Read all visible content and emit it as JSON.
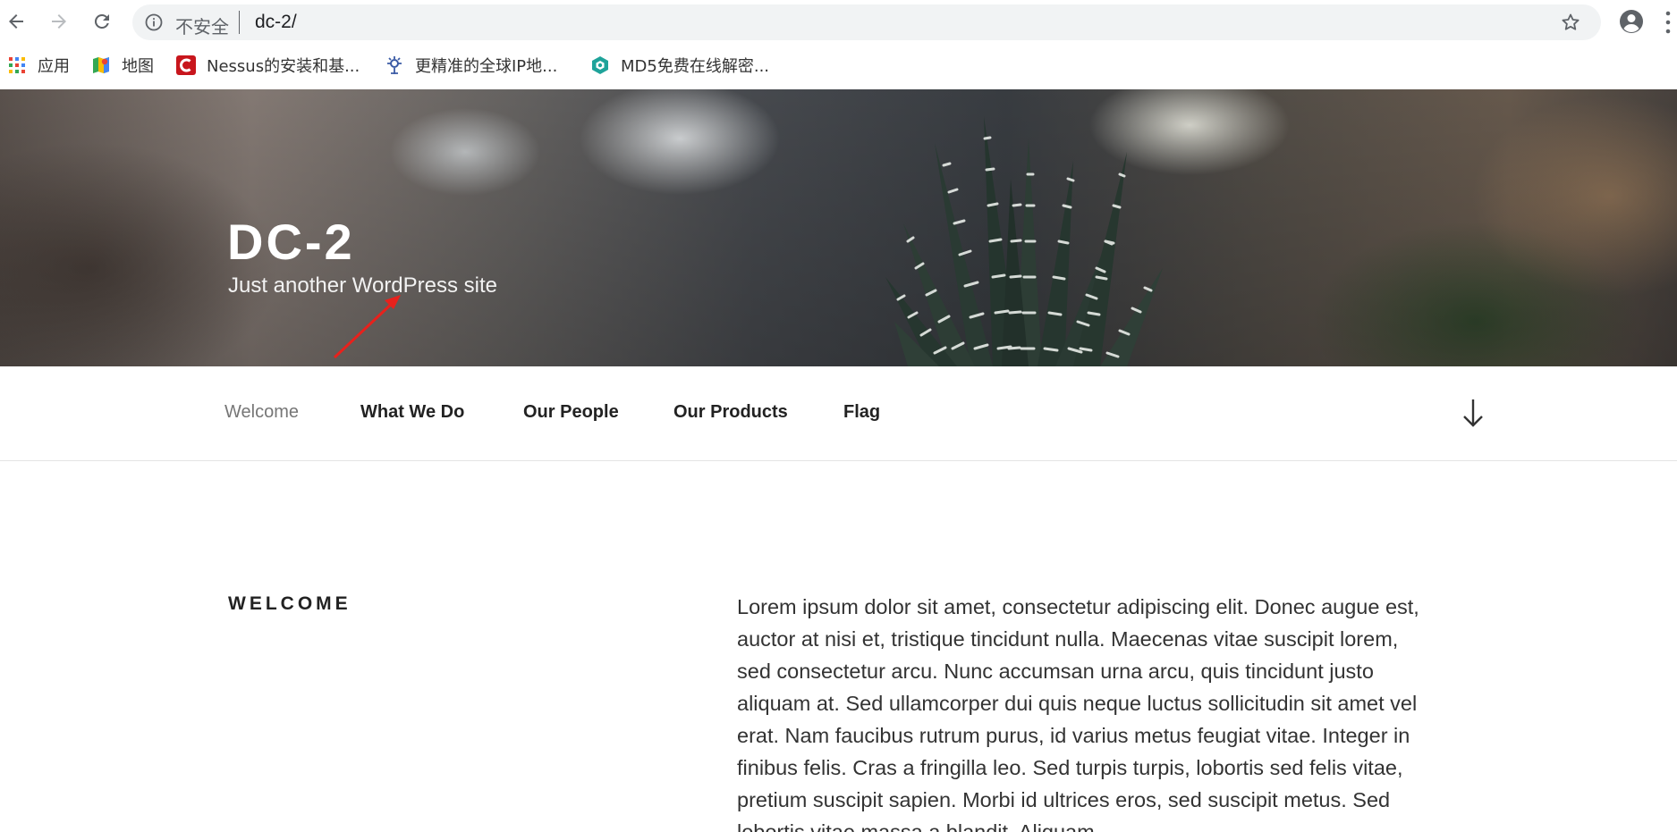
{
  "browser": {
    "security_label": "不安全",
    "url": "dc-2/",
    "bookmarks": [
      {
        "label": "应用",
        "icon": "apps-grid-icon"
      },
      {
        "label": "地图",
        "icon": "maps-icon"
      },
      {
        "label": "Nessus的安装和基...",
        "icon": "csdn-icon"
      },
      {
        "label": "更精准的全球IP地...",
        "icon": "ip-lookup-icon"
      },
      {
        "label": "MD5免费在线解密...",
        "icon": "md5-icon"
      }
    ]
  },
  "site": {
    "title": "DC-2",
    "description": "Just another WordPress site"
  },
  "nav": {
    "items": [
      {
        "label": "Welcome",
        "current": true
      },
      {
        "label": "What We Do"
      },
      {
        "label": "Our People"
      },
      {
        "label": "Our Products"
      },
      {
        "label": "Flag"
      }
    ]
  },
  "content": {
    "section_title": "WELCOME",
    "body": "Lorem ipsum dolor sit amet, consectetur adipiscing elit. Donec augue est, auctor at nisi et, tristique tincidunt nulla. Maecenas vitae suscipit lorem, sed consectetur arcu. Nunc accumsan urna arcu, quis tincidunt justo aliquam at. Sed ullamcorper dui quis neque luctus sollicitudin sit amet vel erat. Nam faucibus rutrum purus, id varius metus feugiat vitae. Integer in finibus felis. Cras a fringilla leo. Sed turpis turpis, lobortis sed felis vitae, pretium suscipit sapien. Morbi id ultrices eros, sed suscipit metus. Sed lobortis vitae massa a blandit. Aliquam"
  },
  "colors": {
    "annotation_arrow": "#e8211c",
    "omnibox_bg": "#f1f3f4"
  }
}
